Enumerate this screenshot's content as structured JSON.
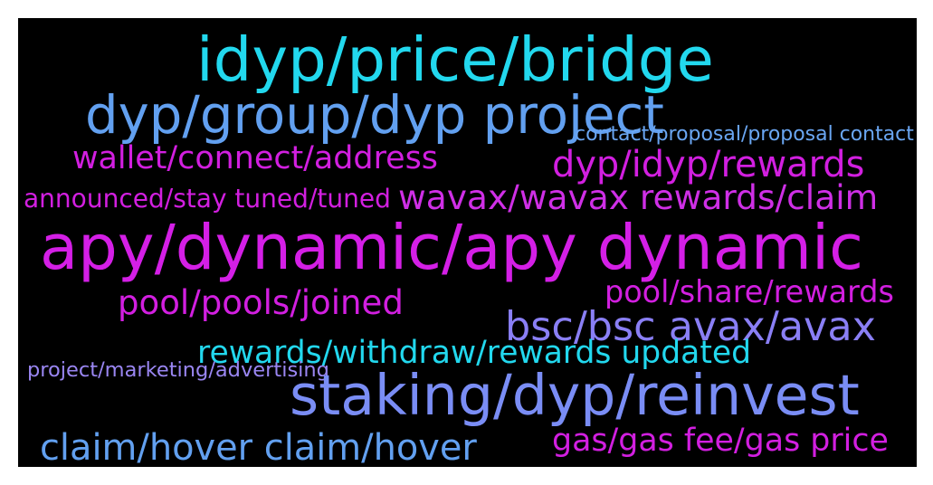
{
  "word_cloud": {
    "words": [
      {
        "text": "idyp/price/bridge",
        "color": "#22d8ee"
      },
      {
        "text": "dyp/group/dyp project",
        "color": "#62a0f0"
      },
      {
        "text": "contact/proposal/proposal contact",
        "color": "#6aa6f2"
      },
      {
        "text": "wallet/connect/address",
        "color": "#d21fe0"
      },
      {
        "text": "dyp/idyp/rewards",
        "color": "#d21fe0"
      },
      {
        "text": "announced/stay tuned/tuned",
        "color": "#d21fe0"
      },
      {
        "text": "wavax/wavax rewards/claim",
        "color": "#cf2fe6"
      },
      {
        "text": "apy/dynamic/apy dynamic",
        "color": "#d41fe6"
      },
      {
        "text": "pool/share/rewards",
        "color": "#d21fe0"
      },
      {
        "text": "pool/pools/joined",
        "color": "#d21fe0"
      },
      {
        "text": "bsc/bsc avax/avax",
        "color": "#8a7ff5"
      },
      {
        "text": "rewards/withdraw/rewards updated",
        "color": "#22d8ee"
      },
      {
        "text": "project/marketing/advertising",
        "color": "#9a86f2"
      },
      {
        "text": "staking/dyp/reinvest",
        "color": "#7a8df5"
      },
      {
        "text": "claim/hover claim/hover",
        "color": "#62a0f0"
      },
      {
        "text": "gas/gas fee/gas price",
        "color": "#d21fe0"
      }
    ]
  }
}
